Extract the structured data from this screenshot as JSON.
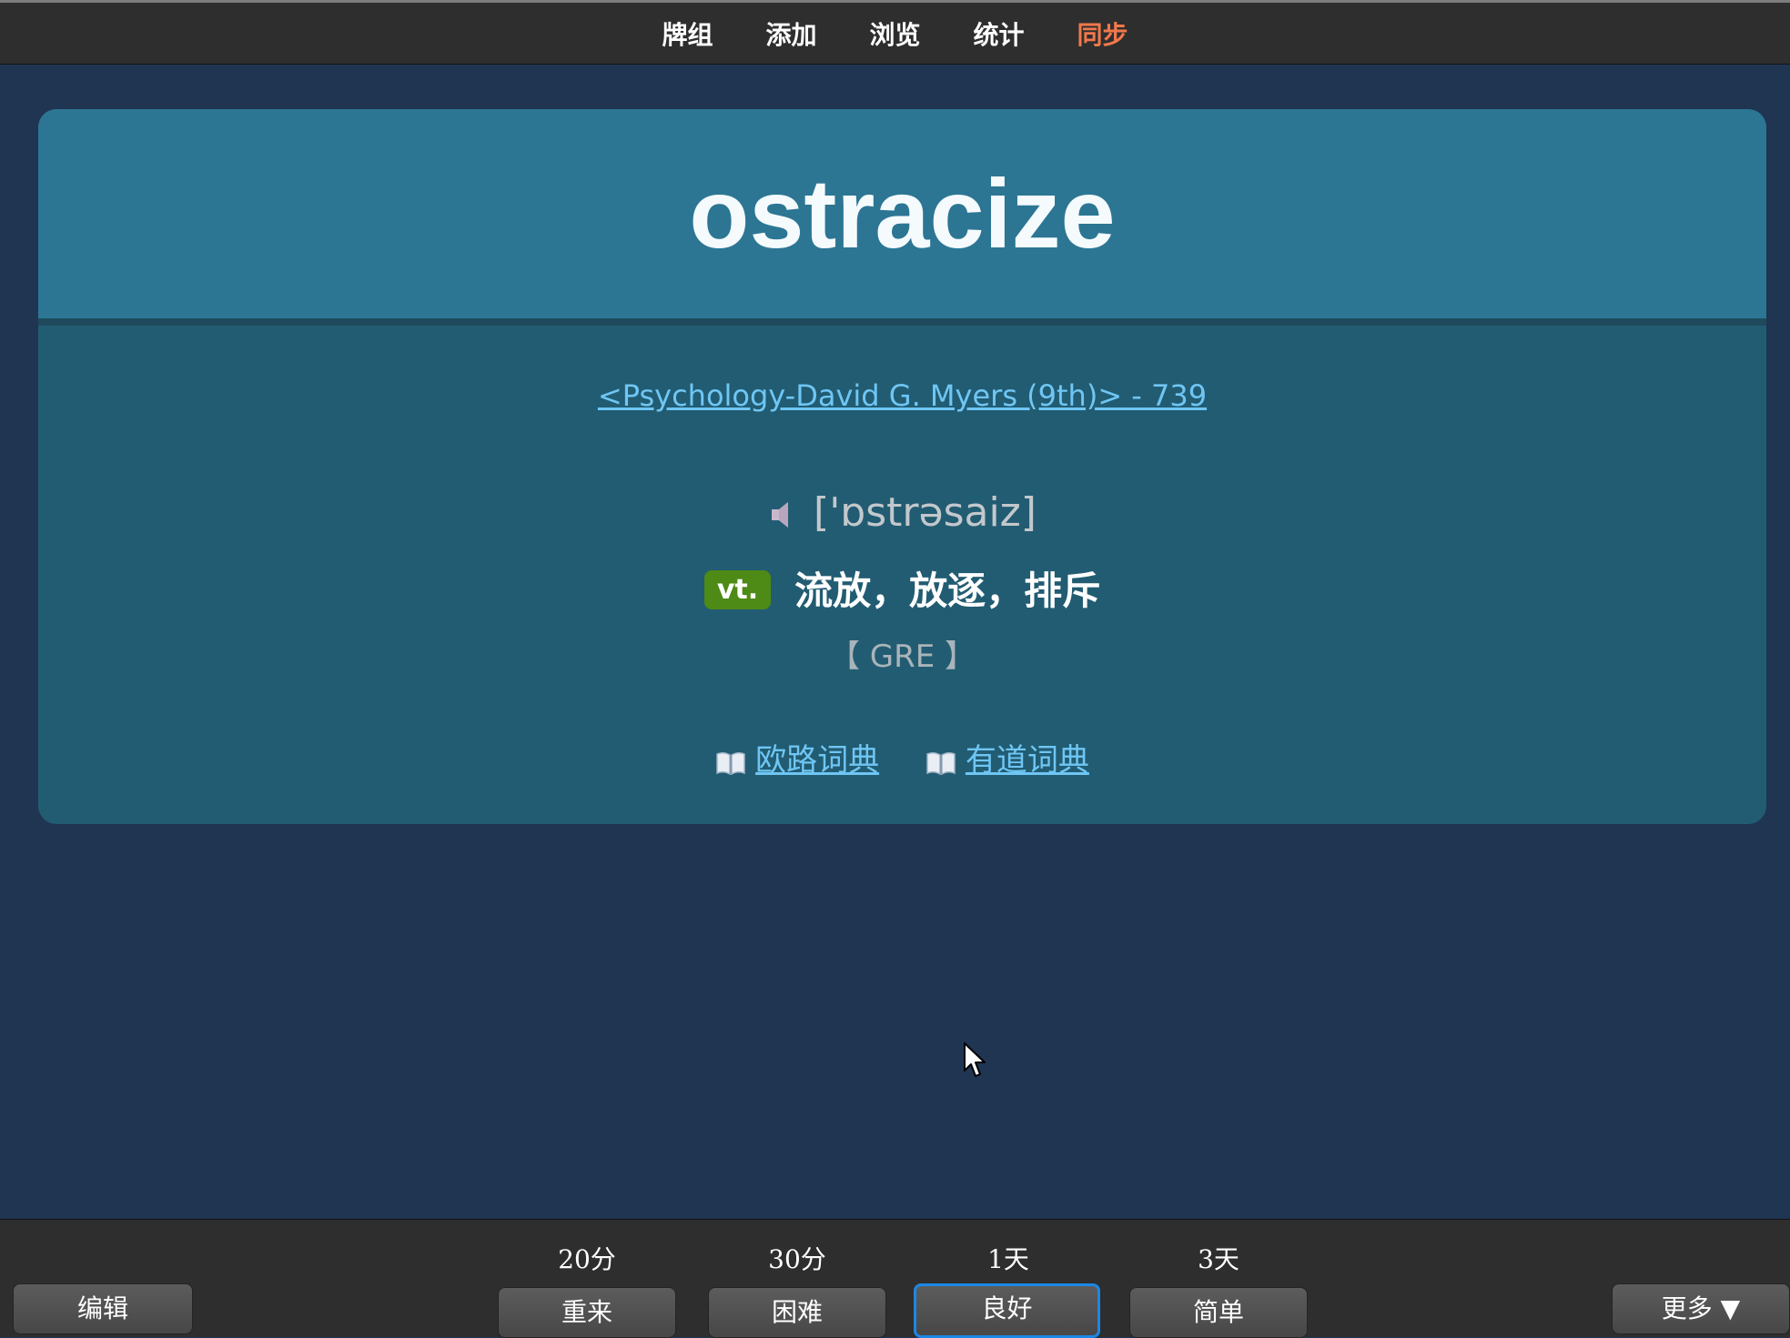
{
  "nav": {
    "items": [
      "牌组",
      "添加",
      "浏览",
      "统计",
      "同步"
    ]
  },
  "card": {
    "word": "ostracize",
    "source": "<Psychology-David G. Myers (9th)> - 739",
    "phonetic": "['ɒstrəsaiz]",
    "pos": "vt.",
    "meaning": "流放，放逐，排斥",
    "tag": "【 GRE 】",
    "dict1": "欧路词典",
    "dict2": "有道词典"
  },
  "bottom": {
    "edit": "编辑",
    "more": "更多 ▼",
    "answers": [
      {
        "interval": "20分",
        "label": "重来"
      },
      {
        "interval": "30分",
        "label": "困难"
      },
      {
        "interval": "1天",
        "label": "良好"
      },
      {
        "interval": "3天",
        "label": "简单"
      }
    ]
  },
  "colors": {
    "background": "#1f3552",
    "card_header": "#2c7694",
    "card_body": "#225c72",
    "link": "#6fc6f4",
    "sync_accent": "#f2784b",
    "pos_badge": "#4d8a16",
    "active_button_border": "#1c87e6"
  },
  "icons": [
    "speaker-icon",
    "book-icon",
    "mouse-cursor-icon"
  ]
}
